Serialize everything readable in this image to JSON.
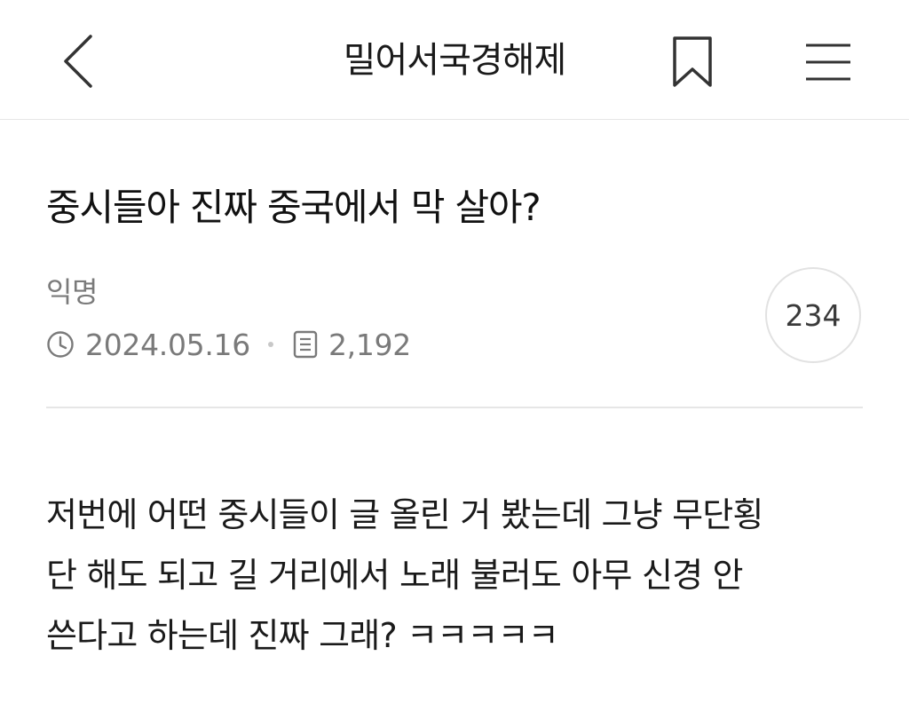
{
  "header": {
    "board_title": "밀어서국경해제",
    "back_icon": "chevron-left-icon",
    "bookmark_icon": "bookmark-icon",
    "menu_icon": "hamburger-menu-icon"
  },
  "post": {
    "title": "중시들아 진짜 중국에서 막 살아?",
    "author": "익명",
    "date": "2024.05.16",
    "views": "2,192",
    "comment_count": "234",
    "body_lines": [
      "저번에 어떤 중시들이 글 올린 거 봤는데 그냥 무단횡",
      "단 해도 되고 길 거리에서 노래 불러도 아무 신경 안",
      "쓴다고 하는데 진짜 그래? ㅋㅋㅋㅋㅋ"
    ]
  },
  "colors": {
    "text_primary": "#1a1a1a",
    "text_secondary": "#7a7a7a",
    "divider": "#e6e6e6",
    "background": "#ffffff"
  }
}
